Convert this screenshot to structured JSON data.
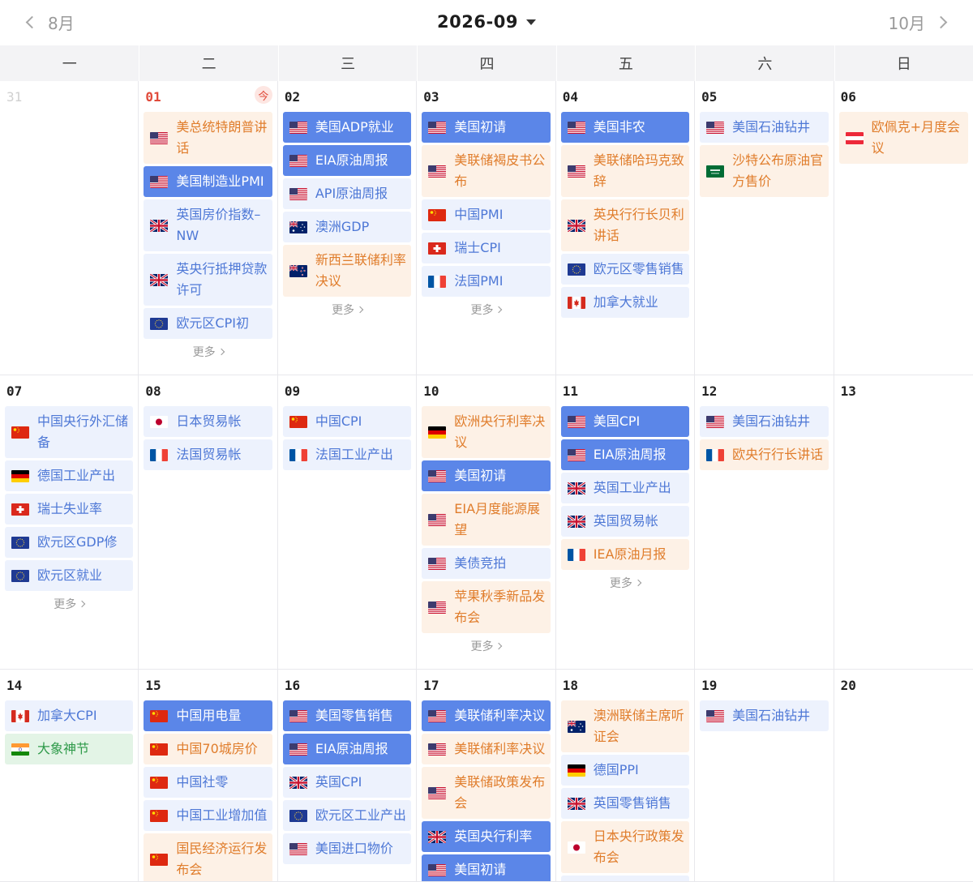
{
  "header": {
    "prev_label": "8月",
    "title": "2026-09",
    "next_label": "10月"
  },
  "weekdays": [
    "一",
    "二",
    "三",
    "四",
    "五",
    "六",
    "日"
  ],
  "more_label": "更多",
  "today_badge": "今",
  "days": [
    {
      "num": "31",
      "muted": true,
      "events": []
    },
    {
      "num": "01",
      "today": true,
      "more": true,
      "events": [
        {
          "t": "美总统特朗普讲话",
          "c": "orange",
          "f": "us"
        },
        {
          "t": "美国制造业PMI",
          "c": "blue",
          "f": "us"
        },
        {
          "t": "英国房价指数–NW",
          "c": "lightblue",
          "f": "uk"
        },
        {
          "t": "英央行抵押贷款许可",
          "c": "lightblue",
          "f": "uk"
        },
        {
          "t": "欧元区CPI初",
          "c": "lightblue",
          "f": "eu"
        }
      ]
    },
    {
      "num": "02",
      "more": true,
      "events": [
        {
          "t": "美国ADP就业",
          "c": "blue",
          "f": "us"
        },
        {
          "t": "EIA原油周报",
          "c": "blue",
          "f": "us"
        },
        {
          "t": "API原油周报",
          "c": "lightblue",
          "f": "us"
        },
        {
          "t": "澳洲GDP",
          "c": "lightblue",
          "f": "au"
        },
        {
          "t": "新西兰联储利率决议",
          "c": "orange",
          "f": "nz"
        }
      ]
    },
    {
      "num": "03",
      "more": true,
      "events": [
        {
          "t": "美国初请",
          "c": "blue",
          "f": "us"
        },
        {
          "t": "美联储褐皮书公布",
          "c": "orange",
          "f": "us"
        },
        {
          "t": "中国PMI",
          "c": "lightblue",
          "f": "cn"
        },
        {
          "t": "瑞士CPI",
          "c": "lightblue",
          "f": "ch"
        },
        {
          "t": "法国PMI",
          "c": "lightblue",
          "f": "fr"
        }
      ]
    },
    {
      "num": "04",
      "events": [
        {
          "t": "美国非农",
          "c": "blue",
          "f": "us"
        },
        {
          "t": "美联储哈玛克致辞",
          "c": "orange",
          "f": "us"
        },
        {
          "t": "英央行行长贝利讲话",
          "c": "orange",
          "f": "uk"
        },
        {
          "t": "欧元区零售销售",
          "c": "lightblue",
          "f": "eu"
        },
        {
          "t": "加拿大就业",
          "c": "lightblue",
          "f": "ca"
        }
      ]
    },
    {
      "num": "05",
      "events": [
        {
          "t": "美国石油钻井",
          "c": "lightblue",
          "f": "us"
        },
        {
          "t": "沙特公布原油官方售价",
          "c": "orange",
          "f": "sa"
        }
      ]
    },
    {
      "num": "06",
      "events": [
        {
          "t": "欧佩克+月度会议",
          "c": "orange",
          "f": "at"
        }
      ]
    },
    {
      "num": "07",
      "more": true,
      "events": [
        {
          "t": "中国央行外汇储备",
          "c": "lightblue",
          "f": "cn"
        },
        {
          "t": "德国工业产出",
          "c": "lightblue",
          "f": "de"
        },
        {
          "t": "瑞士失业率",
          "c": "lightblue",
          "f": "ch"
        },
        {
          "t": "欧元区GDP修",
          "c": "lightblue",
          "f": "eu"
        },
        {
          "t": "欧元区就业",
          "c": "lightblue",
          "f": "eu"
        }
      ]
    },
    {
      "num": "08",
      "events": [
        {
          "t": "日本贸易帐",
          "c": "lightblue",
          "f": "jp"
        },
        {
          "t": "法国贸易帐",
          "c": "lightblue",
          "f": "fr"
        }
      ]
    },
    {
      "num": "09",
      "events": [
        {
          "t": "中国CPI",
          "c": "lightblue",
          "f": "cn"
        },
        {
          "t": "法国工业产出",
          "c": "lightblue",
          "f": "fr"
        }
      ]
    },
    {
      "num": "10",
      "more": true,
      "events": [
        {
          "t": "欧洲央行利率决议",
          "c": "orange",
          "f": "de"
        },
        {
          "t": "美国初请",
          "c": "blue",
          "f": "us"
        },
        {
          "t": "EIA月度能源展望",
          "c": "orange",
          "f": "us"
        },
        {
          "t": "美债竞拍",
          "c": "lightblue",
          "f": "us"
        },
        {
          "t": "苹果秋季新品发布会",
          "c": "orange",
          "f": "us"
        }
      ]
    },
    {
      "num": "11",
      "more": true,
      "events": [
        {
          "t": "美国CPI",
          "c": "blue",
          "f": "us"
        },
        {
          "t": "EIA原油周报",
          "c": "blue",
          "f": "us"
        },
        {
          "t": "英国工业产出",
          "c": "lightblue",
          "f": "uk"
        },
        {
          "t": "英国贸易帐",
          "c": "lightblue",
          "f": "uk"
        },
        {
          "t": "IEA原油月报",
          "c": "orange",
          "f": "fr"
        }
      ]
    },
    {
      "num": "12",
      "events": [
        {
          "t": "美国石油钻井",
          "c": "lightblue",
          "f": "us"
        },
        {
          "t": "欧央行行长讲话",
          "c": "orange",
          "f": "fr"
        }
      ]
    },
    {
      "num": "13",
      "events": []
    },
    {
      "num": "14",
      "events": [
        {
          "t": "加拿大CPI",
          "c": "lightblue",
          "f": "ca"
        },
        {
          "t": "大象神节",
          "c": "green",
          "f": "in"
        }
      ]
    },
    {
      "num": "15",
      "events": [
        {
          "t": "中国用电量",
          "c": "blue",
          "f": "cn"
        },
        {
          "t": "中国70城房价",
          "c": "orange",
          "f": "cn"
        },
        {
          "t": "中国社零",
          "c": "lightblue",
          "f": "cn"
        },
        {
          "t": "中国工业增加值",
          "c": "lightblue",
          "f": "cn"
        },
        {
          "t": "国民经济运行发布会",
          "c": "orange",
          "f": "cn"
        }
      ]
    },
    {
      "num": "16",
      "events": [
        {
          "t": "美国零售销售",
          "c": "blue",
          "f": "us"
        },
        {
          "t": "EIA原油周报",
          "c": "blue",
          "f": "us"
        },
        {
          "t": "英国CPI",
          "c": "lightblue",
          "f": "uk"
        },
        {
          "t": "欧元区工业产出",
          "c": "lightblue",
          "f": "eu"
        },
        {
          "t": "美国进口物价",
          "c": "lightblue",
          "f": "us"
        }
      ]
    },
    {
      "num": "17",
      "events": [
        {
          "t": "美联储利率决议",
          "c": "blue",
          "f": "us"
        },
        {
          "t": "美联储利率决议",
          "c": "orange",
          "f": "us"
        },
        {
          "t": "美联储政策发布会",
          "c": "orange",
          "f": "us"
        },
        {
          "t": "英国央行利率",
          "c": "blue",
          "f": "uk"
        },
        {
          "t": "美国初请",
          "c": "blue",
          "f": "us"
        }
      ]
    },
    {
      "num": "18",
      "events": [
        {
          "t": "澳洲联储主席听证会",
          "c": "orange",
          "f": "au"
        },
        {
          "t": "德国PPI",
          "c": "lightblue",
          "f": "de"
        },
        {
          "t": "英国零售销售",
          "c": "lightblue",
          "f": "uk"
        },
        {
          "t": "日本央行政策发布会",
          "c": "orange",
          "f": "jp"
        },
        {
          "t": "",
          "c": "lightblue",
          "f": "us"
        }
      ]
    },
    {
      "num": "19",
      "events": [
        {
          "t": "美国石油钻井",
          "c": "lightblue",
          "f": "us"
        }
      ]
    },
    {
      "num": "20",
      "events": []
    }
  ]
}
